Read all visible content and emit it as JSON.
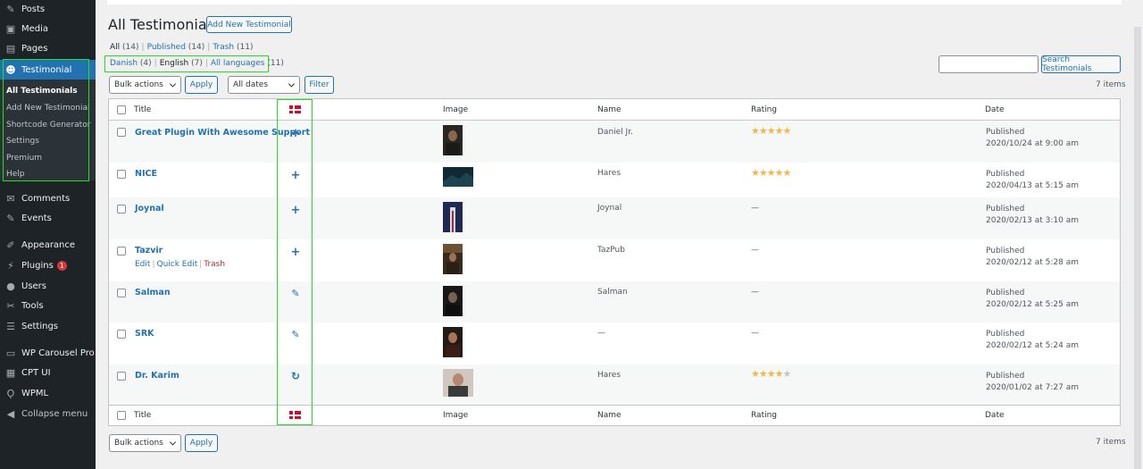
{
  "sidebar": {
    "items": [
      {
        "label": "Posts",
        "icon": "pin-icon"
      },
      {
        "label": "Media",
        "icon": "media-icon"
      },
      {
        "label": "Pages",
        "icon": "pages-icon"
      },
      {
        "label": "Testimonial",
        "icon": "testimonial-icon"
      },
      {
        "label": "Comments",
        "icon": "comments-icon"
      },
      {
        "label": "Events",
        "icon": "events-icon"
      },
      {
        "label": "Appearance",
        "icon": "appearance-icon"
      },
      {
        "label": "Plugins",
        "icon": "plugins-icon",
        "badge": "1"
      },
      {
        "label": "Users",
        "icon": "users-icon"
      },
      {
        "label": "Tools",
        "icon": "tools-icon"
      },
      {
        "label": "Settings",
        "icon": "settings-icon"
      },
      {
        "label": "WP Carousel Pro",
        "icon": "carousel-icon"
      },
      {
        "label": "CPT UI",
        "icon": "cpt-icon"
      },
      {
        "label": "WPML",
        "icon": "wpml-icon"
      },
      {
        "label": "Collapse menu",
        "icon": "collapse-icon"
      }
    ],
    "submenu": [
      "All Testimonials",
      "Add New Testimonial",
      "Shortcode Generator",
      "Settings",
      "Premium",
      "Help"
    ]
  },
  "header": {
    "title": "All Testimonials",
    "add_new": "Add New Testimonial"
  },
  "status_links": {
    "all": "All",
    "all_count": "(14)",
    "published": "Published",
    "published_count": "(14)",
    "trash": "Trash",
    "trash_count": "(11)"
  },
  "lang_links": {
    "danish": "Danish",
    "danish_count": "(4)",
    "english": "English",
    "english_count": "(7)",
    "all_languages": "All languages",
    "all_languages_count": "(11)"
  },
  "search": {
    "placeholder": "",
    "button": "Search Testimonials"
  },
  "filters": {
    "bulk_actions": "Bulk actions",
    "apply": "Apply",
    "all_dates": "All dates",
    "filter": "Filter",
    "items_count": "7 items"
  },
  "table": {
    "columns": {
      "title": "Title",
      "image": "Image",
      "name": "Name",
      "rating": "Rating",
      "date": "Date"
    },
    "rows": [
      {
        "title": "Great Plugin With Awesome Support",
        "lang_icon": "plus-icon",
        "lang_glyph": "+",
        "name": "Daniel Jr.",
        "rating": 5,
        "rating_text": "",
        "status": "Published",
        "date": "2020/10/24 at 9:00 am"
      },
      {
        "title": "NICE",
        "lang_icon": "plus-icon",
        "lang_glyph": "+",
        "name": "Hares",
        "rating": 5,
        "rating_text": "",
        "status": "Published",
        "date": "2020/04/13 at 5:15 am"
      },
      {
        "title": "Joynal",
        "lang_icon": "plus-icon",
        "lang_glyph": "+",
        "name": "Joynal",
        "rating": 0,
        "rating_text": "—",
        "status": "Published",
        "date": "2020/02/13 at 3:10 am"
      },
      {
        "title": "Tazvir",
        "lang_icon": "plus-icon",
        "lang_glyph": "+",
        "name": "TazPub",
        "rating": 0,
        "rating_text": "—",
        "status": "Published",
        "date": "2020/02/12 at 5:28 am",
        "actions": {
          "edit": "Edit",
          "quick_edit": "Quick Edit",
          "trash": "Trash"
        }
      },
      {
        "title": "Salman",
        "lang_icon": "pencil-icon",
        "lang_glyph": "✎",
        "name": "Salman",
        "rating": 0,
        "rating_text": "—",
        "status": "Published",
        "date": "2020/02/12 at 5:25 am"
      },
      {
        "title": "SRK",
        "lang_icon": "pencil-icon",
        "lang_glyph": "✎",
        "name": "—",
        "rating": 0,
        "rating_text": "—",
        "status": "Published",
        "date": "2020/02/12 at 5:24 am"
      },
      {
        "title": "Dr. Karim",
        "lang_icon": "refresh-icon",
        "lang_glyph": "↻",
        "name": "Hares",
        "rating": 4,
        "rating_text": "",
        "status": "Published",
        "date": "2020/01/02 at 7:27 am"
      }
    ]
  },
  "colors": {
    "sidebar_bg": "#1d2327",
    "active": "#2271b1",
    "link": "#2271b1",
    "highlight_box": "#22e01f",
    "star": "#f0b849",
    "trash": "#b32d2e"
  }
}
